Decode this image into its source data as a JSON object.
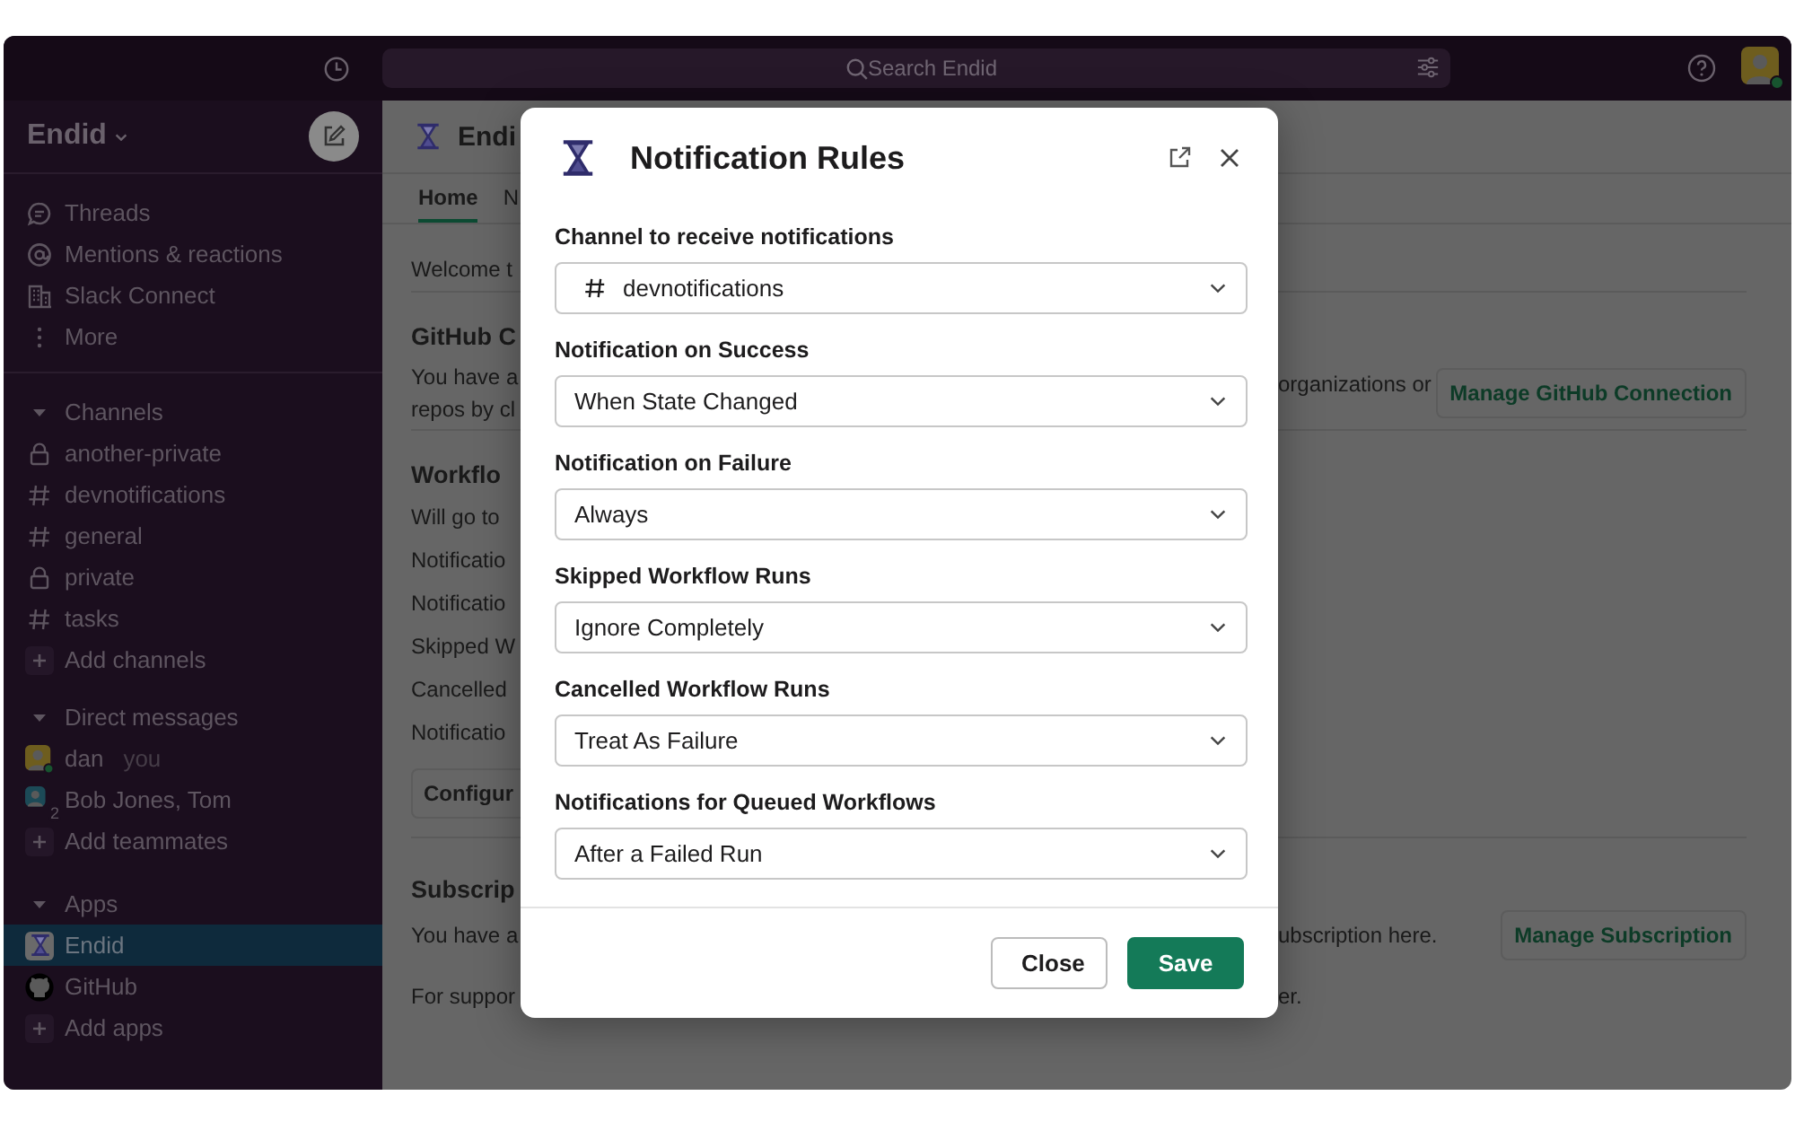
{
  "top_bar": {
    "search": {
      "placeholder": "Search Endid"
    }
  },
  "sidebar": {
    "workspace": "Endid",
    "nav": [
      {
        "kind": "threads",
        "label": "Threads"
      },
      {
        "kind": "mentions",
        "label": "Mentions & reactions"
      },
      {
        "kind": "connect",
        "label": "Slack Connect"
      },
      {
        "kind": "more",
        "label": "More"
      }
    ],
    "sections": [
      {
        "title": "Channels",
        "expanded": true,
        "items": [
          {
            "kind": "private",
            "label": "another-private",
            "selected": false
          },
          {
            "kind": "public",
            "label": "devnotifications",
            "selected": false
          },
          {
            "kind": "public",
            "label": "general",
            "selected": false
          },
          {
            "kind": "private",
            "label": "private",
            "selected": false
          },
          {
            "kind": "public",
            "label": "tasks",
            "selected": false
          },
          {
            "kind": "add",
            "label": "Add channels",
            "selected": false
          }
        ]
      },
      {
        "title": "Direct messages",
        "expanded": true,
        "items": [
          {
            "kind": "user",
            "label": "dan",
            "note": "you",
            "selected": false
          },
          {
            "kind": "group",
            "label": "Bob Jones, Tom",
            "count": "2",
            "selected": false
          },
          {
            "kind": "add",
            "label": "Add teammates",
            "selected": false
          }
        ]
      },
      {
        "title": "Apps",
        "expanded": true,
        "items": [
          {
            "kind": "endid",
            "label": "Endid",
            "selected": true
          },
          {
            "kind": "github",
            "label": "GitHub",
            "selected": false
          },
          {
            "kind": "add",
            "label": "Add apps",
            "selected": false
          }
        ]
      }
    ]
  },
  "app_header": {
    "title": "Endi"
  },
  "tabs": [
    {
      "label": "Home",
      "selected": true
    },
    {
      "label": "N",
      "selected": false
    }
  ],
  "rows": [
    {
      "kind": "text",
      "left": [
        "Welcome t"
      ]
    },
    {
      "kind": "divider"
    },
    {
      "kind": "heading",
      "left": [
        "GitHub C"
      ]
    },
    {
      "kind": "text",
      "left": [
        "You have a",
        "repos by cl"
      ],
      "right": "organizations or",
      "button": "Manage GitHub Connection"
    },
    {
      "kind": "divider"
    },
    {
      "kind": "heading",
      "left": [
        "Workflo"
      ]
    },
    {
      "kind": "text",
      "left": [
        "Will go to"
      ]
    },
    {
      "kind": "text",
      "left": [
        "Notificatio"
      ]
    },
    {
      "kind": "text",
      "left": [
        "Notificatio"
      ]
    },
    {
      "kind": "text",
      "left": [
        "Skipped W"
      ]
    },
    {
      "kind": "text",
      "left": [
        "Cancelled"
      ]
    },
    {
      "kind": "text",
      "left": [
        "Notificatio"
      ]
    },
    {
      "kind": "button",
      "left": [
        "Configur"
      ]
    },
    {
      "kind": "divider"
    },
    {
      "kind": "heading",
      "left": [
        "Subscrip"
      ]
    },
    {
      "kind": "text",
      "left": [
        "You have a"
      ],
      "right": "ubscription here.",
      "button": "Manage Subscription"
    },
    {
      "kind": "text",
      "left": [
        "For suppor"
      ],
      "right": "er."
    }
  ],
  "modal": {
    "title": "Notification Rules",
    "fields": [
      {
        "kind": "channel",
        "label": "Channel to receive notifications",
        "value": "devnotifications"
      },
      {
        "kind": "select",
        "label": "Notification on Success",
        "value": "When State Changed"
      },
      {
        "kind": "select",
        "label": "Notification on Failure",
        "value": "Always"
      },
      {
        "kind": "select",
        "label": "Skipped Workflow Runs",
        "value": "Ignore Completely"
      },
      {
        "kind": "select",
        "label": "Cancelled Workflow Runs",
        "value": "Treat As Failure"
      },
      {
        "kind": "select",
        "label": "Notifications for Queued Workflows",
        "value": "After a Failed Run"
      }
    ],
    "buttons": [
      {
        "kind": "secondary",
        "label": "Close"
      },
      {
        "kind": "primary",
        "label": "Save"
      }
    ]
  }
}
